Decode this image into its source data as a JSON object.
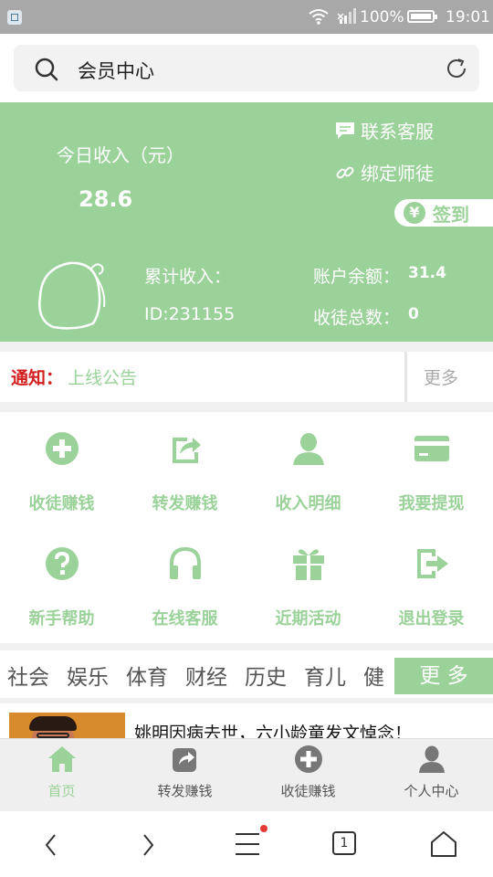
{
  "status_bar": {
    "battery": "100%",
    "time": "19:01"
  },
  "search": {
    "title": "会员中心"
  },
  "hero": {
    "today_label": "今日收入（元）",
    "today_value": "28.6",
    "contact_label": "联系客服",
    "bind_label": "绑定师徒",
    "signin_label": "签到",
    "total_label": "累计收入：",
    "id_text": "ID:231155",
    "balance_label": "账户余额：",
    "balance_value": "31.4",
    "apprentice_label": "收徒总数：",
    "apprentice_value": "0",
    "accent_color": "#9bd29a"
  },
  "notice": {
    "label": "通知：",
    "text": "上线公告",
    "more": "更多"
  },
  "grid": [
    {
      "label": "收徒赚钱",
      "icon": "plus-circle-icon"
    },
    {
      "label": "转发赚钱",
      "icon": "share-icon"
    },
    {
      "label": "收入明细",
      "icon": "user-icon"
    },
    {
      "label": "我要提现",
      "icon": "card-icon"
    },
    {
      "label": "新手帮助",
      "icon": "question-icon"
    },
    {
      "label": "在线客服",
      "icon": "headphones-icon"
    },
    {
      "label": "近期活动",
      "icon": "gift-icon"
    },
    {
      "label": "退出登录",
      "icon": "logout-icon"
    }
  ],
  "categories": {
    "items": [
      "社会",
      "娱乐",
      "体育",
      "财经",
      "历史",
      "育儿",
      "健"
    ],
    "more": "更 多"
  },
  "news": {
    "title": "姚明因病去世，六小龄童发文悼念！"
  },
  "bottom_nav": [
    {
      "label": "首页",
      "icon": "home-icon",
      "active": true
    },
    {
      "label": "转发赚钱",
      "icon": "share-icon",
      "active": false
    },
    {
      "label": "收徒赚钱",
      "icon": "plus-circle-icon",
      "active": false
    },
    {
      "label": "个人中心",
      "icon": "user-icon",
      "active": false
    }
  ],
  "system_nav": {
    "tab_count": "1"
  }
}
